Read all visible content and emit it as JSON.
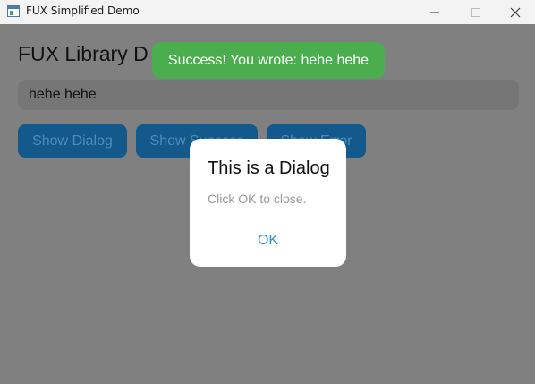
{
  "window": {
    "title": "FUX Simplified Demo",
    "icon": "app-window-icon",
    "controls": [
      "minimize-icon",
      "maximize-icon",
      "close-icon"
    ]
  },
  "main": {
    "title": "FUX Library D",
    "input": {
      "value": "hehe hehe"
    },
    "buttons": [
      {
        "label": "Show Dialog"
      },
      {
        "label": "Show Success"
      },
      {
        "label": "Show Error"
      }
    ]
  },
  "toast": {
    "message": "Success! You wrote: hehe hehe",
    "color": "#4aad4e"
  },
  "dialog": {
    "title": "This is a Dialog",
    "message": "Click OK to close.",
    "ok_label": "OK",
    "ok_color": "#2a8fcf"
  },
  "colors": {
    "overlay": "#808080",
    "button_bg": "#13598c"
  }
}
